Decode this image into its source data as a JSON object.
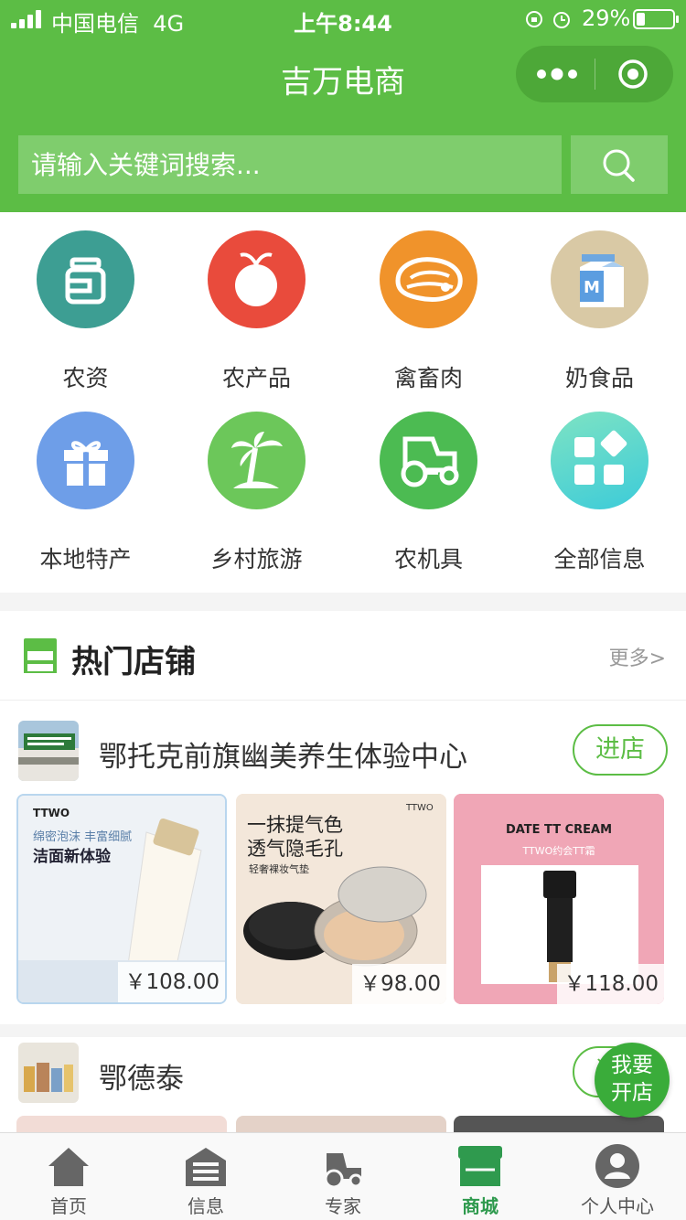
{
  "status_bar": {
    "carrier": "中国电信",
    "network": "4G",
    "time": "上午8:44",
    "battery": "29%"
  },
  "header": {
    "title": "吉万电商",
    "more_icon": "more-dots-icon",
    "target_icon": "target-icon"
  },
  "search": {
    "placeholder": "请输入关键词搜索...",
    "button_icon": "search-icon"
  },
  "categories": [
    {
      "label": "农资",
      "icon": "bottle-icon",
      "color": "#3d9e93"
    },
    {
      "label": "农产品",
      "icon": "apple-icon",
      "color": "#e94b3c"
    },
    {
      "label": "禽畜肉",
      "icon": "steak-icon",
      "color": "#f0932b"
    },
    {
      "label": "奶食品",
      "icon": "milk-carton-icon",
      "color": "#d9c9a5"
    },
    {
      "label": "本地特产",
      "icon": "gift-icon",
      "color": "#6e9ee8"
    },
    {
      "label": "乡村旅游",
      "icon": "palm-tree-icon",
      "color": "#6cc75a"
    },
    {
      "label": "农机具",
      "icon": "tractor-icon",
      "color": "#4cbb52"
    },
    {
      "label": "全部信息",
      "icon": "apps-icon",
      "color": "#4fd8b8"
    }
  ],
  "hot_shops": {
    "title": "热门店铺",
    "more": "更多>",
    "shops": [
      {
        "name": "鄂托克前旗幽美养生体验中心",
        "enter_label": "进店",
        "products": [
          {
            "price": "￥108.00",
            "brand": "TTWO",
            "headline": "洁面新体验",
            "tagline": "绵密泡沫 丰富细腻"
          },
          {
            "price": "￥98.00",
            "brand": "TTWO",
            "headline": "一抹提气色",
            "tagline": "透气隐毛孔",
            "sub": "轻奢裸妆气垫"
          },
          {
            "price": "￥118.00",
            "headline": "DATE TT CREAM",
            "tagline": "TTWO约会TT霜"
          }
        ]
      },
      {
        "name": "鄂德泰",
        "enter_label": "进店"
      }
    ]
  },
  "floating_button": {
    "line1": "我要",
    "line2": "开店"
  },
  "tabbar": [
    {
      "label": "首页",
      "icon": "home-icon",
      "active": false
    },
    {
      "label": "信息",
      "icon": "news-icon",
      "active": false
    },
    {
      "label": "专家",
      "icon": "tractor-icon",
      "active": false
    },
    {
      "label": "商城",
      "icon": "store-icon",
      "active": true
    },
    {
      "label": "个人中心",
      "icon": "user-icon",
      "active": false
    }
  ],
  "colors": {
    "brand_green": "#5cbd45",
    "active_tab": "#2f9a4e"
  }
}
